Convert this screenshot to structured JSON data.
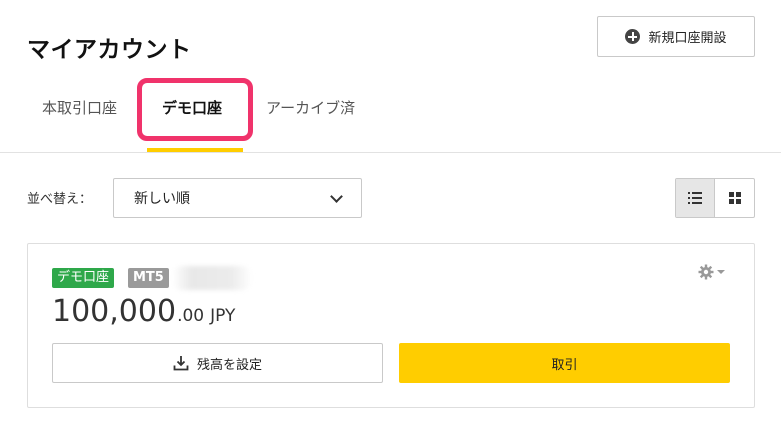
{
  "header": {
    "title": "マイアカウント",
    "new_account_label": "新規口座開設"
  },
  "tabs": {
    "real": "本取引口座",
    "demo": "デモ口座",
    "archive": "アーカイブ済",
    "active": "demo"
  },
  "sort": {
    "label": "並べ替え：",
    "selected": "新しい順"
  },
  "view_toggle": {
    "active": "list"
  },
  "account": {
    "type_badge": "デモ口座",
    "platform_badge": "MT5",
    "balance_integer": "100,000",
    "balance_decimal": ".00",
    "currency": "JPY",
    "set_balance_label": "残高を設定",
    "trade_label": "取引"
  },
  "colors": {
    "accent_yellow": "#ffcd00",
    "demo_badge_green": "#2ea84a",
    "highlight_pink": "#f0336b"
  }
}
